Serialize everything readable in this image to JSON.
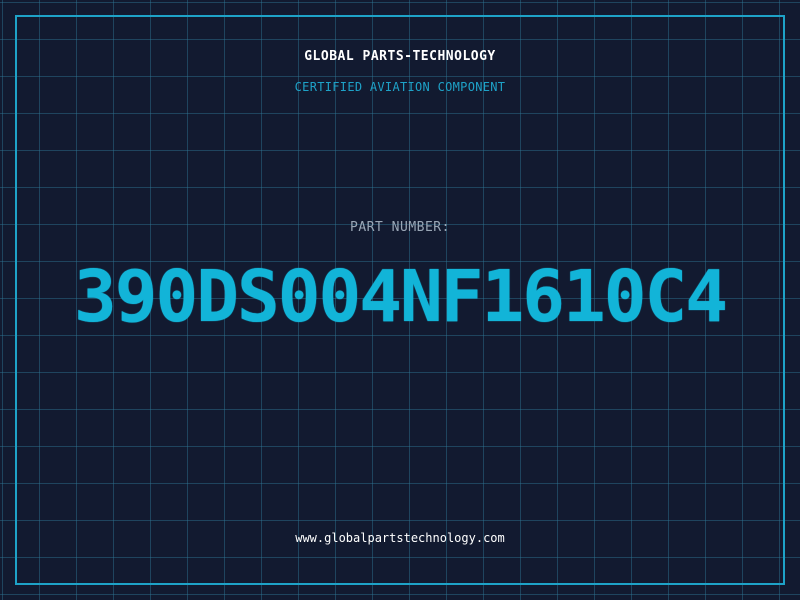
{
  "header": {
    "company_name": "GLOBAL PARTS-TECHNOLOGY",
    "subtitle": "CERTIFIED AVIATION COMPONENT"
  },
  "part": {
    "label": "PART NUMBER:",
    "number": "390DS004NF1610C4"
  },
  "footer": {
    "website": "www.globalpartstechnology.com"
  },
  "colors": {
    "background": "#121a30",
    "grid": "#2e7896",
    "accent": "#1ea2c8",
    "part_number": "#12b4d8",
    "label": "#9aa7b6",
    "text": "#ffffff"
  }
}
